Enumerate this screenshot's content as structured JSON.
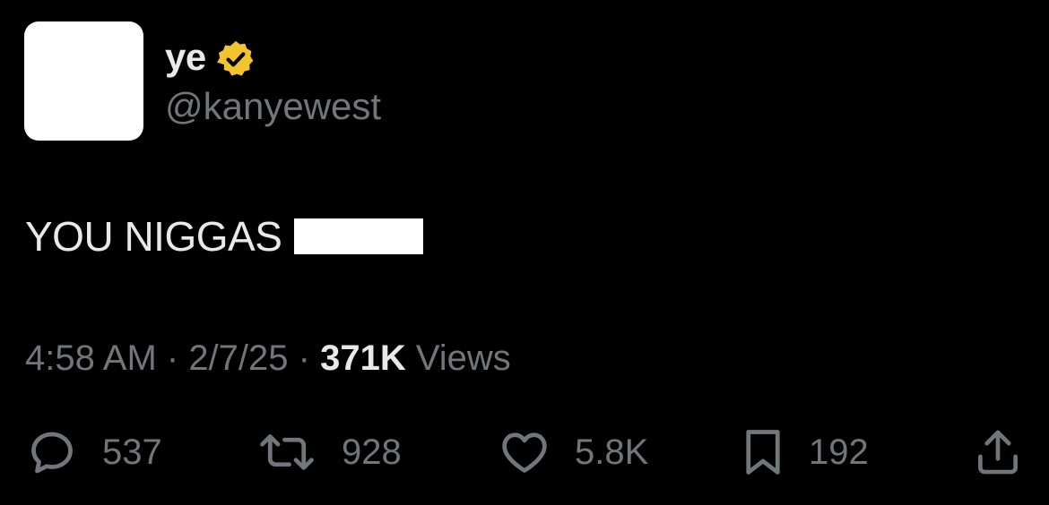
{
  "author": {
    "display_name": "ye",
    "handle": "@kanyewest",
    "verified_badge": "verified-badge-icon",
    "badge_color": "#f4c430"
  },
  "tweet": {
    "text": "YOU NIGGAS"
  },
  "meta": {
    "time": "4:58 AM",
    "sep1": " · ",
    "date": "2/7/25",
    "sep2": " · ",
    "views_count": "371K",
    "views_label": " Views"
  },
  "actions": {
    "reply_count": "537",
    "retweet_count": "928",
    "like_count": "5.8K",
    "bookmark_count": "192"
  },
  "colors": {
    "background": "#000000",
    "primary_text": "#e7e9ea",
    "secondary_text": "#71767b"
  }
}
